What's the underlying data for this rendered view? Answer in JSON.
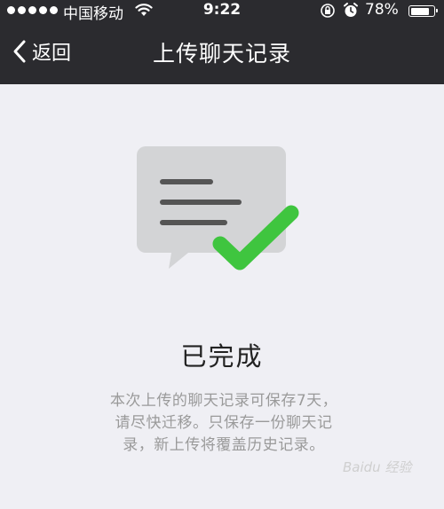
{
  "status_bar": {
    "carrier": "中国移动",
    "time": "9:22",
    "battery": "78%"
  },
  "nav": {
    "back_label": "返回",
    "title": "上传聊天记录"
  },
  "main": {
    "done_title": "已完成",
    "description": "本次上传的聊天记录可保存7天，请尽快迁移。只保存一份聊天记录，新上传将覆盖历史记录。"
  },
  "colors": {
    "nav_bg": "#2b2b2f",
    "page_bg": "#efeff4",
    "check_green": "#3fc53f",
    "bubble_gray": "#d3d4d6"
  },
  "watermark": "Baidu 经验"
}
